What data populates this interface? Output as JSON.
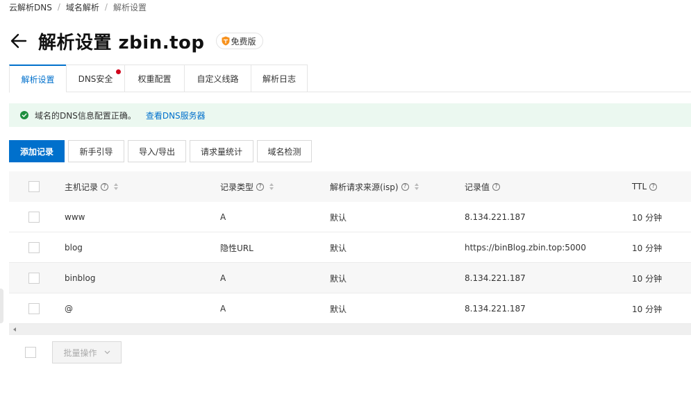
{
  "breadcrumb": {
    "items": [
      "云解析DNS",
      "域名解析",
      "解析设置"
    ],
    "separator": "/"
  },
  "header": {
    "title": "解析设置 zbin.top",
    "badge": "免费版"
  },
  "tabs": [
    {
      "label": "解析设置",
      "active": true,
      "dot": false
    },
    {
      "label": "DNS安全",
      "active": false,
      "dot": true
    },
    {
      "label": "权重配置",
      "active": false,
      "dot": false
    },
    {
      "label": "自定义线路",
      "active": false,
      "dot": false
    },
    {
      "label": "解析日志",
      "active": false,
      "dot": false
    }
  ],
  "notice": {
    "text": "域名的DNS信息配置正确。",
    "link": "查看DNS服务器"
  },
  "toolbar": {
    "add": "添加记录",
    "guide": "新手引导",
    "import_export": "导入/导出",
    "stats": "请求量统计",
    "check": "域名检测"
  },
  "table": {
    "columns": {
      "host": "主机记录",
      "type": "记录类型",
      "isp": "解析请求来源(isp)",
      "value": "记录值",
      "ttl": "TTL"
    },
    "rows": [
      {
        "host": "www",
        "type": "A",
        "isp": "默认",
        "value": "8.134.221.187",
        "ttl": "10 分钟"
      },
      {
        "host": "blog",
        "type": "隐性URL",
        "isp": "默认",
        "value": "https://binBlog.zbin.top:5000",
        "ttl": "10 分钟"
      },
      {
        "host": "binblog",
        "type": "A",
        "isp": "默认",
        "value": "8.134.221.187",
        "ttl": "10 分钟"
      },
      {
        "host": "@",
        "type": "A",
        "isp": "默认",
        "value": "8.134.221.187",
        "ttl": "10 分钟"
      }
    ]
  },
  "footer": {
    "batch_label": "批量操作"
  },
  "colors": {
    "accent": "#0070cc",
    "success": "#1e8e3e",
    "notice_bg": "#ebf8f0",
    "dot": "#d0021b"
  },
  "icons": {
    "back": "arrow-left-icon",
    "badge": "shield-icon",
    "notice": "check-circle-icon",
    "help": "question-circle-icon",
    "sort": "sort-icon",
    "batch": "chevron-down-icon"
  }
}
